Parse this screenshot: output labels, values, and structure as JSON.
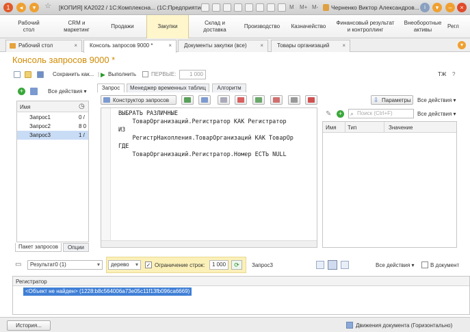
{
  "window": {
    "app_title": "[КОПИЯ] КА2022 / 1С:Комплексна... (1С:Предприятие)",
    "user": "Черненко Виктор Александров...",
    "title_btn_m": "M",
    "title_btn_mplus": "M+",
    "title_btn_mminus": "M-"
  },
  "sections": [
    {
      "label": "Рабочий\nстол"
    },
    {
      "label": "CRM и\nмаркетинг"
    },
    {
      "label": "Продажи"
    },
    {
      "label": "Закупки"
    },
    {
      "label": "Склад и\nдоставка"
    },
    {
      "label": "Производство"
    },
    {
      "label": "Казначейство"
    },
    {
      "label": "Финансовый результат\nи контроллинг"
    },
    {
      "label": "Внеоборотные\nактивы"
    },
    {
      "label": "Регл"
    }
  ],
  "tabs": [
    {
      "label": "Рабочий стол"
    },
    {
      "label": "Консоль запросов 9000 *"
    },
    {
      "label": "Документы закупки (все)"
    },
    {
      "label": "Товары организаций"
    }
  ],
  "page_title": "Консоль запросов 9000 *",
  "toolbar": {
    "save_as": "Сохранить как...",
    "execute": "Выполнить",
    "first_label": "ПЕРВЫЕ:",
    "first_value": "1 000",
    "tj": "ТЖ"
  },
  "left_panel": {
    "all_actions": "Все действия",
    "col_name": "Имя",
    "rows": [
      {
        "name": "Запрос1",
        "value": "0 /"
      },
      {
        "name": "Запрос2",
        "value": "8 0"
      },
      {
        "name": "Запрос3",
        "value": "1 /"
      }
    ],
    "tab_packet": "Пакет запросов",
    "tab_options": "Опции"
  },
  "query_tabs": [
    {
      "label": "Запрос"
    },
    {
      "label": "Менеджер временных таблиц"
    },
    {
      "label": "Алгоритм"
    }
  ],
  "editor": {
    "constructor_btn": "Конструктор запросов",
    "lines": [
      "ВЫБРАТЬ РАЗЛИЧНЫЕ",
      "    ТоварОрганизаций.Регистратор КАК Регистратор",
      "ИЗ",
      "    РегистрНакопления.ТоварОрганизаций КАК ТоварОр",
      "ГДЕ",
      "    ТоварОрганизаций.Регистратор.Номер ЕСТЬ NULL"
    ]
  },
  "params": {
    "params_btn": "Параметры",
    "all_actions": "Все действия",
    "search_placeholder": "Поиск (Ctrl+F)",
    "col_name": "Имя",
    "col_type": "Тип",
    "col_value": "Значение"
  },
  "results_bar": {
    "result_select": "Результат0 (1)",
    "view_select": "дерево",
    "limit_label": "Ограничение строк:",
    "limit_value": "1 000",
    "query_name": "Запрос3",
    "all_actions": "Все действия",
    "in_document": "В документ"
  },
  "result_table": {
    "col_registrar": "Регистратор",
    "row_value": "<Объект не найден> (1228:b8c564006a73e05c11f13fb096ca6669)"
  },
  "status": {
    "history": "История...",
    "right": "Движения документа (Горизонтально)"
  },
  "colors": {
    "accent": "#d08a00",
    "active_section": "#fff6cc",
    "selection": "#3f7fd6"
  }
}
